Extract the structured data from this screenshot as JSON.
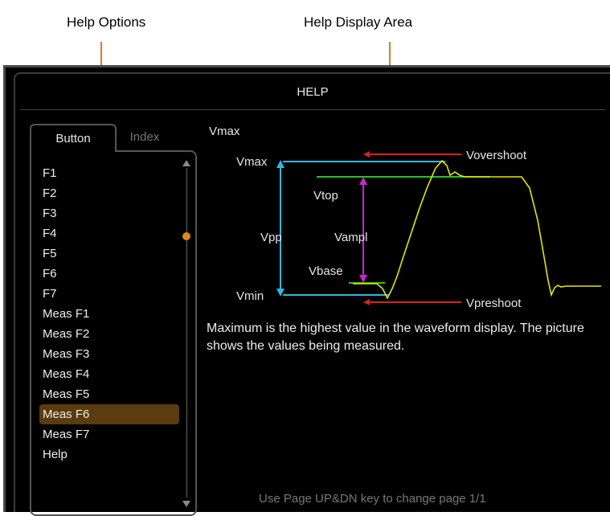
{
  "callouts": {
    "help_options": "Help Options",
    "help_display_area": "Help Display Area"
  },
  "dialog": {
    "title": "HELP"
  },
  "tabs": [
    {
      "label": "Button",
      "active": true
    },
    {
      "label": "Index",
      "active": false
    }
  ],
  "list": {
    "items": [
      "F1",
      "F2",
      "F3",
      "F4",
      "F5",
      "F6",
      "F7",
      "Meas F1",
      "Meas F2",
      "Meas F3",
      "Meas F4",
      "Meas F5",
      "Meas F6",
      "Meas F7",
      "Help"
    ],
    "selected": "Meas F6"
  },
  "topic": {
    "heading": "Vmax",
    "description": "Maximum is the highest value in the waveform display. The picture shows the values being measured."
  },
  "diagram_labels": {
    "vmax": "Vmax",
    "vtop": "Vtop",
    "vpp": "Vpp",
    "vampl": "Vampl",
    "vbase": "Vbase",
    "vmin": "Vmin",
    "vovershoot": "Vovershoot",
    "vpreshoot": "Vpreshoot"
  },
  "footer": {
    "text": "Use Page UP&DN key to change page  1/1"
  },
  "colors": {
    "accent_orange": "#e07a1f",
    "selection": "#5a3c0f",
    "waveform": "#e6e600",
    "cyan": "#2fb8e0",
    "green": "#22c422",
    "magenta": "#d020d0",
    "red": "#e02020"
  }
}
